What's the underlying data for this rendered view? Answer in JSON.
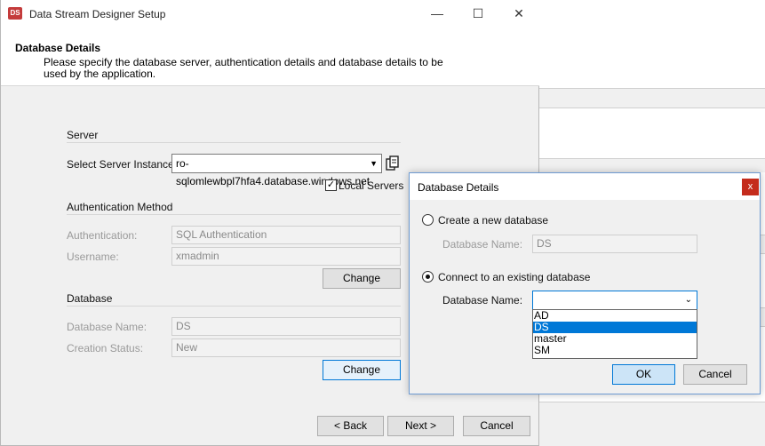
{
  "window": {
    "title": "Data Stream Designer Setup",
    "icon_text": "DS",
    "controls": {
      "minimize": "—",
      "maximize": "☐",
      "close": "✕"
    }
  },
  "header": {
    "title": "Database Details",
    "description": "Please specify the database server, authentication details and database details to be used by the application."
  },
  "server": {
    "section": "Server",
    "instance_label": "Select Server Instance:",
    "instance_value": "ro-sqlomlewbpl7hfa4.database.windows.net",
    "local_servers_label": "Local Servers",
    "local_servers_checked": true
  },
  "auth": {
    "section": "Authentication Method",
    "authentication_label": "Authentication:",
    "authentication_value": "SQL Authentication",
    "username_label": "Username:",
    "username_value": "xmadmin",
    "change_label": "Change"
  },
  "database": {
    "section": "Database",
    "name_label": "Database Name:",
    "name_value": "DS",
    "status_label": "Creation Status:",
    "status_value": "New",
    "change_label": "Change"
  },
  "footer": {
    "back_label": "< Back",
    "next_label": "Next >",
    "cancel_label": "Cancel"
  },
  "dialog": {
    "title": "Database Details",
    "close": "x",
    "create_new_label": "Create a new database",
    "create_name_label": "Database Name:",
    "create_name_value": "DS",
    "connect_existing_label": "Connect to an existing database",
    "connect_name_label": "Database Name:",
    "connect_name_value": "",
    "options": [
      "AD",
      "DS",
      "master",
      "SM"
    ],
    "highlighted_option": "DS",
    "ok_label": "OK",
    "cancel_label": "Cancel"
  },
  "colors": {
    "accent": "#0078d7",
    "close_red": "#c42b1c",
    "window_bg": "#f0f0f0"
  }
}
